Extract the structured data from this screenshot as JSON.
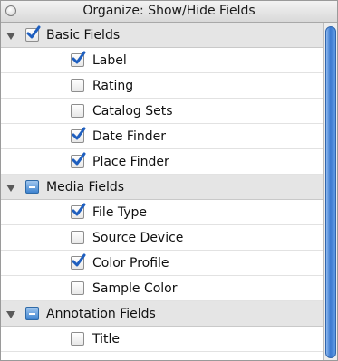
{
  "window": {
    "title": "Organize: Show/Hide Fields"
  },
  "groups": [
    {
      "label": "Basic Fields",
      "state": "checked",
      "items": [
        {
          "label": "Label",
          "checked": true
        },
        {
          "label": "Rating",
          "checked": false
        },
        {
          "label": "Catalog Sets",
          "checked": false
        },
        {
          "label": "Date Finder",
          "checked": true
        },
        {
          "label": "Place Finder",
          "checked": true
        }
      ]
    },
    {
      "label": "Media Fields",
      "state": "mixed",
      "items": [
        {
          "label": "File Type",
          "checked": true
        },
        {
          "label": "Source Device",
          "checked": false
        },
        {
          "label": "Color Profile",
          "checked": true
        },
        {
          "label": "Sample Color",
          "checked": false
        }
      ]
    },
    {
      "label": "Annotation Fields",
      "state": "mixed",
      "items": [
        {
          "label": "Title",
          "checked": false
        }
      ]
    }
  ],
  "colors": {
    "accent": "#3f84d0",
    "checkmark": "#1f5fbf",
    "group_row": "#e5e5e5"
  }
}
